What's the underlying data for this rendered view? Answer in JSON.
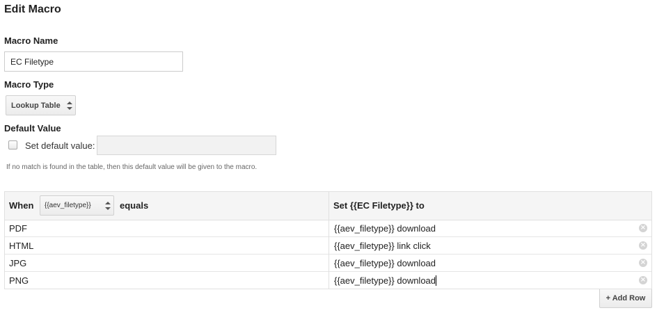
{
  "page": {
    "title": "Edit Macro"
  },
  "macro_name": {
    "label": "Macro Name",
    "value": "EC Filetype"
  },
  "macro_type": {
    "label": "Macro Type",
    "selected": "Lookup Table"
  },
  "default_value": {
    "label": "Default Value",
    "checkbox_label": "Set default value:",
    "checked": false,
    "value": "",
    "help_text": "If no match is found in the table, then this default value will be given to the macro."
  },
  "lookup_table": {
    "when_label": "When",
    "variable_selected": "{{aev_filetype}}",
    "equals_label": "equals",
    "set_label": "Set {{EC Filetype}} to",
    "rows": [
      {
        "when": "PDF",
        "set": "{{aev_filetype}} download"
      },
      {
        "when": "HTML",
        "set": "{{aev_filetype}} link click"
      },
      {
        "when": "JPG",
        "set": "{{aev_filetype}} download"
      },
      {
        "when": "PNG",
        "set": "{{aev_filetype}} download"
      }
    ],
    "remove_glyph": "×",
    "add_row_label": "+ Add Row"
  }
}
